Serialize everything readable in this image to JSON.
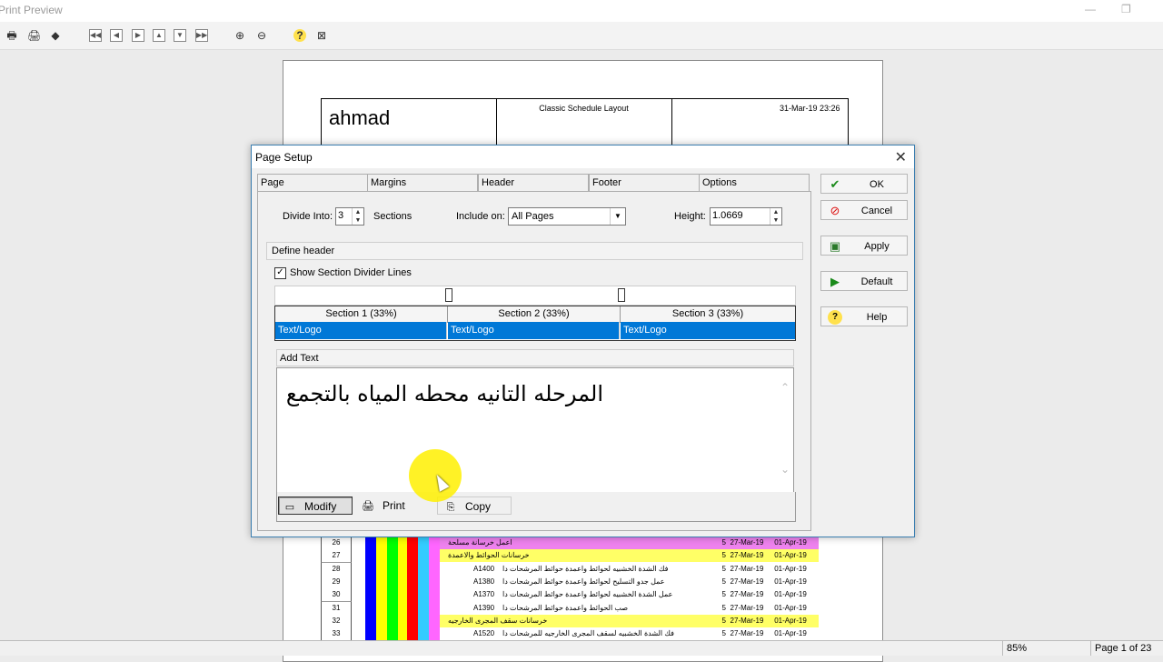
{
  "window": {
    "title": "Print Preview"
  },
  "toolbar": {
    "icons": [
      "page-setup-icon",
      "print-icon",
      "export-icon",
      "first-page-icon",
      "prev-page-icon",
      "next-page-icon",
      "prev-record-icon",
      "next-record-icon",
      "last-page-icon",
      "zoom-in-icon",
      "zoom-out-icon",
      "help-icon",
      "close-preview-icon"
    ]
  },
  "preview": {
    "header_name": "ahmad",
    "header_layout": "Classic Schedule Layout",
    "header_date": "31-Mar-19 23:26",
    "rows": [
      {
        "num": "26",
        "code": "",
        "text": "اعمل خرسانة مسلحة",
        "dur": "5",
        "start": "27-Mar-19",
        "finish": "01-Apr-19",
        "bg": "#ee82ee"
      },
      {
        "num": "27",
        "code": "",
        "text": "خرسانات الحوائط والاعمدة",
        "dur": "5",
        "start": "27-Mar-19",
        "finish": "01-Apr-19",
        "bg": "#ffff66"
      },
      {
        "num": "28",
        "code": "A1400",
        "text": "فك الشدة الخشبيه لحوائط واعمدة حوائط المرشحات دا",
        "dur": "5",
        "start": "27-Mar-19",
        "finish": "01-Apr-19",
        "bg": "#ffffff"
      },
      {
        "num": "29",
        "code": "A1380",
        "text": "عمل جدو التسليح لحوائط واعمدة حوائط المرشحات دا",
        "dur": "5",
        "start": "27-Mar-19",
        "finish": "01-Apr-19",
        "bg": "#ffffff"
      },
      {
        "num": "30",
        "code": "A1370",
        "text": "عمل الشدة الخشبيه لحوائط واعمدة حوائط المرشحات دا",
        "dur": "5",
        "start": "27-Mar-19",
        "finish": "01-Apr-19",
        "bg": "#ffffff"
      },
      {
        "num": "31",
        "code": "A1390",
        "text": "صب الحوائط واعمدة حوائط المرشحات دا",
        "dur": "5",
        "start": "27-Mar-19",
        "finish": "01-Apr-19",
        "bg": "#ffffff"
      },
      {
        "num": "32",
        "code": "",
        "text": "خرسانات سقف المجرى الخارجيه",
        "dur": "5",
        "start": "27-Mar-19",
        "finish": "01-Apr-19",
        "bg": "#ffff66"
      },
      {
        "num": "33",
        "code": "A1520",
        "text": "فك الشدة الخشبيه لسقف المجرى الخارجيه للمرشحات دا",
        "dur": "5",
        "start": "27-Mar-19",
        "finish": "01-Apr-19",
        "bg": "#ffffff"
      }
    ]
  },
  "dialog": {
    "title": "Page Setup",
    "tabs": [
      "Page",
      "Margins",
      "Header",
      "Footer",
      "Options"
    ],
    "divide_label": "Divide Into:",
    "divide_value": "3",
    "sections_label": "Sections",
    "include_label": "Include on:",
    "include_value": "All Pages",
    "height_label": "Height:",
    "height_value": "1.0669",
    "define_header": "Define header",
    "show_dividers": "Show Section Divider Lines",
    "sections": [
      {
        "head": "Section 1 (33%)",
        "value": "Text/Logo"
      },
      {
        "head": "Section 2 (33%)",
        "value": "Text/Logo"
      },
      {
        "head": "Section 3 (33%)",
        "value": "Text/Logo"
      }
    ],
    "add_text": "Add Text",
    "text_content": "المرحله التانيه محطه المياه بالتجمع",
    "modify": "Modify",
    "print": "Print",
    "copy": "Copy",
    "buttons": {
      "ok": "OK",
      "cancel": "Cancel",
      "apply": "Apply",
      "default": "Default",
      "help": "Help"
    }
  },
  "status": {
    "zoom": "85%",
    "page": "Page 1 of 23"
  }
}
